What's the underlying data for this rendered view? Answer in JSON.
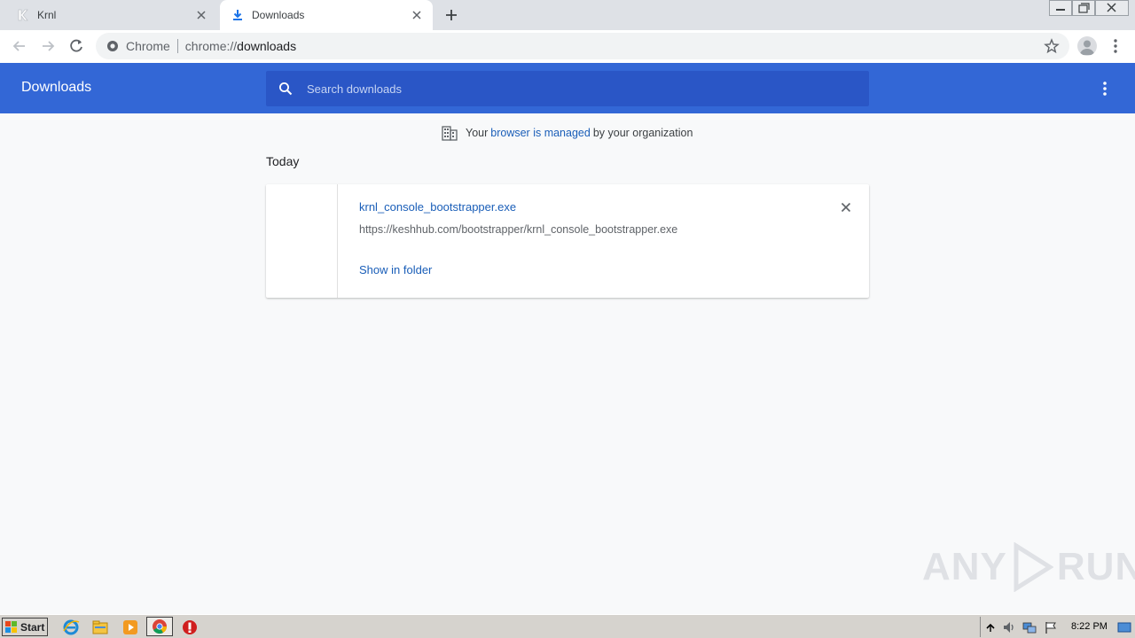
{
  "tabs": [
    {
      "title": "Krnl",
      "active": false
    },
    {
      "title": "Downloads",
      "active": true
    }
  ],
  "omnibox": {
    "chip": "Chrome",
    "url_prefix": "chrome://",
    "url_host": "downloads"
  },
  "header": {
    "title": "Downloads",
    "search_placeholder": "Search downloads"
  },
  "managed_notice": {
    "prefix": "Your",
    "link": "browser is managed",
    "suffix": "by your organization"
  },
  "section_label": "Today",
  "download_item": {
    "filename": "krnl_console_bootstrapper.exe",
    "url": "https://keshhub.com/bootstrapper/krnl_console_bootstrapper.exe",
    "action": "Show in folder"
  },
  "watermark": {
    "left": "ANY",
    "right": "RUN"
  },
  "taskbar": {
    "start_label": "Start",
    "clock": "8:22 PM",
    "pinned_icons": [
      "ie-icon",
      "explorer-icon",
      "media-player-icon",
      "chrome-icon",
      "stop-icon"
    ]
  },
  "colors": {
    "header_blue": "#3367d6",
    "search_blue": "#2a56c6",
    "link_blue": "#1a5eb8"
  }
}
